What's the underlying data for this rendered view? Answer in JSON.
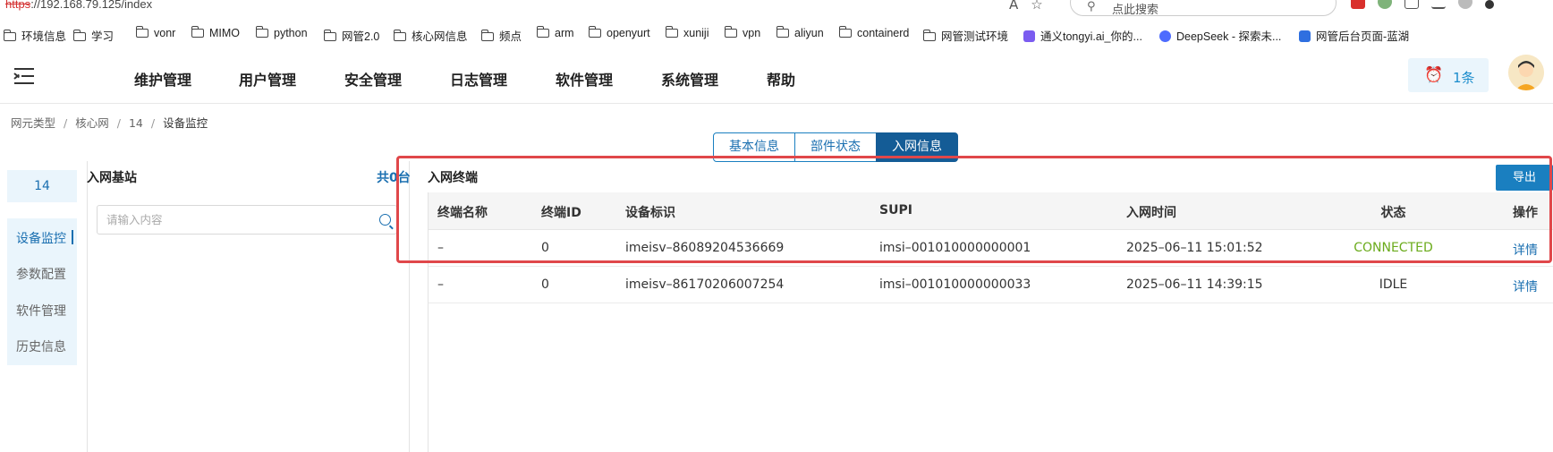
{
  "browser": {
    "url_proto": "https",
    "url_rest": "://192.168.79.125/index",
    "search_placeholder": "点此搜索",
    "bookmarks": [
      "环境信息",
      "学习",
      "vonr",
      "MIMO",
      "python",
      "网管2.0",
      "核心网信息",
      "频点",
      "arm",
      "openyurt",
      "xuniji",
      "vpn",
      "aliyun",
      "containerd",
      "网管测试环境",
      "通义tongyi.ai_你的...",
      "DeepSeek - 探索未...",
      "网管后台页面-蓝湖"
    ]
  },
  "header": {
    "nav": [
      "维护管理",
      "用户管理",
      "安全管理",
      "日志管理",
      "软件管理",
      "系统管理",
      "帮助"
    ],
    "alert_count": "1条"
  },
  "breadcrumb": [
    "网元类型",
    "核心网",
    "14",
    "设备监控"
  ],
  "tabs": [
    "基本信息",
    "部件状态",
    "入网信息"
  ],
  "active_tab": "入网信息",
  "sidebar": {
    "title": "14",
    "items": [
      "设备监控",
      "参数配置",
      "软件管理",
      "历史信息"
    ],
    "active": "设备监控"
  },
  "base_station": {
    "title": "入网基站",
    "count": "共0台",
    "search_placeholder": "请输入内容"
  },
  "terminals": {
    "title": "入网终端",
    "export_label": "导出",
    "columns": [
      "终端名称",
      "终端ID",
      "设备标识",
      "SUPI",
      "入网时间",
      "状态",
      "操作"
    ],
    "rows": [
      {
        "name": "–",
        "id": "0",
        "device": "imeisv–86089204536669",
        "supi": "imsi–001010000000001",
        "time": "2025–06–11 15:01:52",
        "status": "CONNECTED",
        "op": "详情"
      },
      {
        "name": "–",
        "id": "0",
        "device": "imeisv–86170206007254",
        "supi": "imsi–001010000000033",
        "time": "2025–06–11 14:39:15",
        "status": "IDLE",
        "op": "详情"
      }
    ]
  },
  "colors": {
    "accent": "#1a7fc0",
    "connected": "#6bab1c",
    "highlight": "#e0474a"
  }
}
